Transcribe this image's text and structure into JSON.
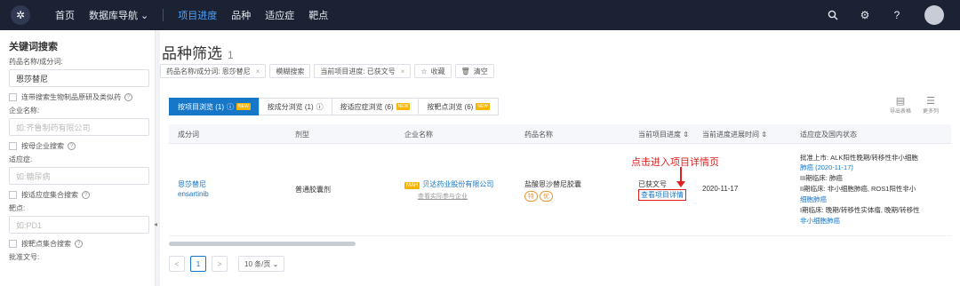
{
  "topnav": {
    "items": [
      "首页",
      "数据库导航 ⌄",
      "项目进度",
      "品种",
      "适应症",
      "靶点"
    ],
    "icons": [
      "search-icon",
      "settings-icon",
      "help-icon",
      "avatar"
    ]
  },
  "left": {
    "title": "关键词搜索",
    "drug_label": "药品名称/成分词:",
    "drug_value": "恩莎替尼",
    "biosim_label": "连带搜索生物制品原研及类似药",
    "company_label": "企业名称:",
    "company_placeholder": "如:齐鲁制药有限公司",
    "group_label": "按母企业搜索",
    "indication_label": "适应症:",
    "indication_placeholder": "如:糖尿病",
    "ind_set_label": "按适应症集合搜索",
    "target_label": "靶点:",
    "target_placeholder": "如:PD1",
    "target_set_label": "按靶点集合搜索",
    "approval_label": "批准文号:"
  },
  "main": {
    "title": "品种筛选",
    "count": "1",
    "chips": {
      "c1": "药品名称/成分词: 恩莎替尼",
      "c2": "模糊搜索",
      "c3": "当前项目进度: 已获文号",
      "c4": "收藏",
      "c5": "清空"
    },
    "tabs": {
      "t1": "按项目浏览 (1)",
      "t2": "按成分浏览 (1)",
      "t3": "按适应症浏览 (6)",
      "t4": "按靶点浏览 (6)",
      "new": "NEW"
    },
    "tools": {
      "export": "导出表格",
      "more": "更多列"
    },
    "headers": {
      "h1": "成分词",
      "h2": "剂型",
      "h3": "企业名称",
      "h4": "药品名称",
      "h5": "当前项目进度 ⇕",
      "h6": "当前进度进展时间 ⇕",
      "h7": "适应症及国内状态"
    },
    "row": {
      "ingredient_cn": "恩莎替尼",
      "ingredient_en": "ensartinib",
      "dosage": "普通胶囊剂",
      "mah": "MAH",
      "company": "贝达药业股份有限公司",
      "company_sub": "查看实际参与企业",
      "drug": "盐酸恩沙替尼胶囊",
      "pill1": "特",
      "pill2": "优",
      "progress": "已获文号",
      "detail": "查看项目详情",
      "date": "2020-11-17",
      "status_1": "批准上市: ALK阳性晚期/转移性非小细胞",
      "status_2": "肺癌 (2020-11-17)",
      "status_3": "III期临床: 肺癌",
      "status_4": "II期临床: 非小细胞肺癌, ROS1阳性非小",
      "status_5": "细胞肺癌",
      "status_6": "I期临床: 晚期/转移性实体瘤, 晚期/转移性",
      "status_7": "非小细胞肺癌"
    },
    "annotation": "点击进入项目详情页",
    "pager": {
      "prev": "<",
      "page": "1",
      "next": ">",
      "size": "10 条/页 ⌄"
    }
  }
}
